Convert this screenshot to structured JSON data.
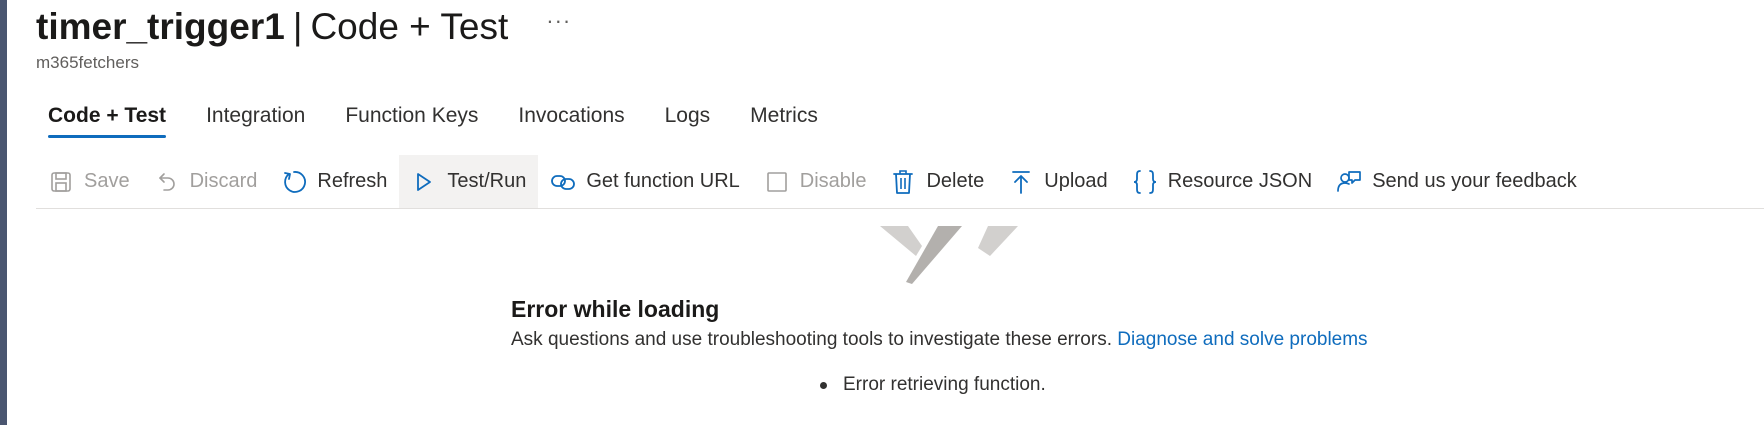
{
  "header": {
    "function_name": "timer_trigger1",
    "separator": "|",
    "page_name": "Code + Test",
    "more_label": "···",
    "subtitle": "m365fetchers"
  },
  "tabs": [
    {
      "label": "Code + Test",
      "active": true
    },
    {
      "label": "Integration",
      "active": false
    },
    {
      "label": "Function Keys",
      "active": false
    },
    {
      "label": "Invocations",
      "active": false
    },
    {
      "label": "Logs",
      "active": false
    },
    {
      "label": "Metrics",
      "active": false
    }
  ],
  "toolbar": {
    "save": {
      "label": "Save",
      "icon": "save-icon",
      "disabled": true
    },
    "discard": {
      "label": "Discard",
      "icon": "undo-icon",
      "disabled": true
    },
    "refresh": {
      "label": "Refresh",
      "icon": "refresh-icon",
      "disabled": false
    },
    "test_run": {
      "label": "Test/Run",
      "icon": "play-icon",
      "disabled": false
    },
    "get_url": {
      "label": "Get function URL",
      "icon": "link-icon",
      "disabled": false
    },
    "disable": {
      "label": "Disable",
      "icon": "checkbox-icon",
      "disabled": true
    },
    "delete": {
      "label": "Delete",
      "icon": "trash-icon",
      "disabled": false
    },
    "upload": {
      "label": "Upload",
      "icon": "upload-icon",
      "disabled": false
    },
    "resource_json": {
      "label": "Resource JSON",
      "icon": "braces-icon",
      "disabled": false
    },
    "feedback": {
      "label": "Send us your feedback",
      "icon": "feedback-icon",
      "disabled": false
    }
  },
  "error": {
    "title": "Error while loading",
    "description": "Ask questions and use troubleshooting tools to investigate these errors.",
    "link_label": "Diagnose and solve problems",
    "items": [
      "Error retrieving function."
    ]
  },
  "colors": {
    "accent": "#0f6cbd",
    "text": "#323130",
    "disabled": "#a19f9d",
    "left_rail": "#4a5670"
  }
}
